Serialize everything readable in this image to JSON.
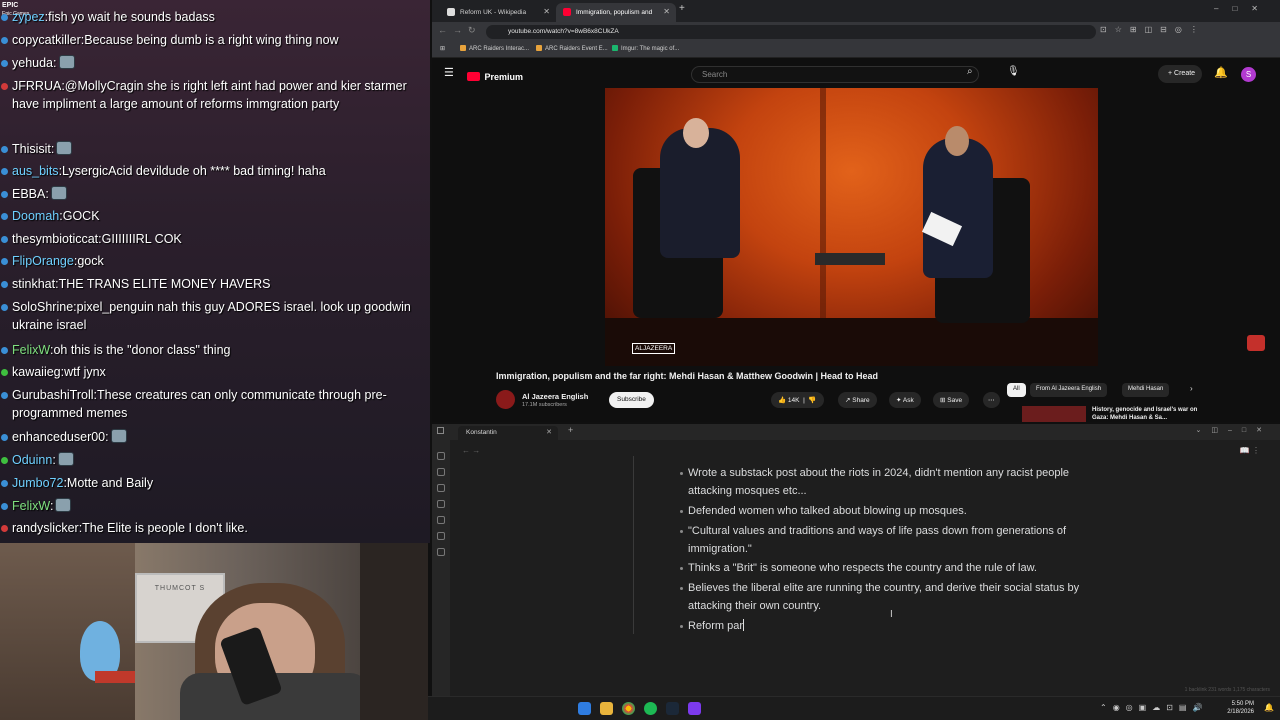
{
  "chat": {
    "epic_badge": "EPIC\nEpic Games",
    "messages": [
      {
        "user": "zypez",
        "text": "fish yo wait he sounds badass",
        "user_color": "#6fd0ff",
        "dot": "#3a8fd6"
      },
      {
        "user": "copycatkiller",
        "text": "Because being dumb is a right wing thing now",
        "user_color": "#ffffff",
        "dot": "#3a8fd6"
      },
      {
        "user": "yehuda",
        "text": "",
        "user_color": "#ffffff",
        "dot": "#3a8fd6",
        "emote": true
      },
      {
        "user": "JFRRUA",
        "text": "@MollyCragin she is right left aint had power and kier starmer have impliment a large amount of reforms immgration party",
        "user_color": "#ffffff",
        "dot": "#d23a3a"
      },
      {
        "user": "Thisisit",
        "text": "",
        "user_color": "#ffffff",
        "dot": "#3a8fd6",
        "emote": true
      },
      {
        "user": "aus_bits",
        "text": "LysergicAcid devildude oh **** bad timing! haha",
        "user_color": "#6fd0ff",
        "dot": "#3a8fd6"
      },
      {
        "user": "EBBA",
        "text": "",
        "user_color": "#ffffff",
        "dot": "#3a8fd6",
        "emote": true
      },
      {
        "user": "Doomah",
        "text": "GOCK",
        "user_color": "#6fd0ff",
        "dot": "#3a8fd6"
      },
      {
        "user": "thesymbioticcat",
        "text": "GIIIIIIIRL COK",
        "user_color": "#ffffff",
        "dot": "#3a8fd6"
      },
      {
        "user": "FlipOrange",
        "text": "gock",
        "user_color": "#6fd0ff",
        "dot": "#3a8fd6"
      },
      {
        "user": "stinkhat",
        "text": "THE TRANS ELITE MONEY HAVERS",
        "user_color": "#ffffff",
        "dot": "#3a8fd6"
      },
      {
        "user": "SoloShrine",
        "text": "pixel_penguin nah this guy ADORES israel. look up goodwin ukraine israel",
        "user_color": "#ffffff",
        "dot": "#3a8fd6"
      },
      {
        "user": "FelixW",
        "text": "oh this is the \"donor class\" thing",
        "user_color": "#7fe07f",
        "dot": "#3a8fd6"
      },
      {
        "user": "kawaiieg",
        "text": "wtf jynx",
        "user_color": "#ffffff",
        "dot": "#3fbf3f"
      },
      {
        "user": "GurubashiTroll",
        "text": "These creatures can only communicate through pre-programmed memes",
        "user_color": "#ffffff",
        "dot": "#3a8fd6"
      },
      {
        "user": "enhanceduser00",
        "text": "",
        "user_color": "#ffffff",
        "dot": "#3a8fd6",
        "emote": true
      },
      {
        "user": "Oduinn",
        "text": "",
        "user_color": "#6fd0ff",
        "dot": "#3fbf3f",
        "emote": true
      },
      {
        "user": "Jumbo72",
        "text": "Motte and Baily",
        "user_color": "#6fd0ff",
        "dot": "#3a8fd6"
      },
      {
        "user": "FelixW",
        "text": "",
        "user_color": "#7fe07f",
        "dot": "#3a8fd6",
        "emote": true
      },
      {
        "user": "randyslicker",
        "text": "The Elite is people I don't like.",
        "user_color": "#ffffff",
        "dot": "#d23a3a"
      }
    ]
  },
  "webcam": {
    "sign_text": "THUMCOT S"
  },
  "browser": {
    "tabs": [
      {
        "label": "Reform UK - Wikipedia",
        "active": false
      },
      {
        "label": "Immigration, populism and",
        "active": true
      }
    ],
    "url": "youtube.com/watch?v=8wB6x8CUkZA",
    "bookmarks": [
      "ARC Raiders Interac...",
      "ARC Raiders Event E...",
      "Imgur: The magic of..."
    ],
    "youtube": {
      "logo": "Premium",
      "search_placeholder": "Search",
      "create_label": "Create",
      "avatar_letter": "S",
      "video_watermark": "ALJAZEERA",
      "title": "Immigration, populism and the far right: Mehdi Hasan & Matthew Goodwin | Head to Head",
      "channel_name": "Al Jazeera English",
      "channel_subs": "17.1M subscribers",
      "subscribe_label": "Subscribe",
      "likes": "14K",
      "share_label": "Share",
      "ask_label": "Ask",
      "save_label": "Save",
      "chips": [
        "All",
        "From Al Jazeera English",
        "Mehdi Hasan"
      ],
      "rec_title": "History, genocide and Israel's war on Gaza: Mehdi Hasan & Sa..."
    }
  },
  "notes": {
    "tab_title": "Konstantin",
    "bullets": [
      "Wrote a substack post about the riots in 2024, didn't mention any racist people attacking mosques etc...",
      "Defended women who talked about blowing up mosques.",
      "\"Cultural values and traditions and ways of life pass down from generations of immigration.\"",
      "Thinks a \"Brit\" is someone who respects the country and the rule of law.",
      "Believes the liberal elite are running the country, and derive their social status by attacking their own country.",
      "Reform par"
    ],
    "status": "1 backlink   231 words   1,175 characters"
  },
  "taskbar": {
    "time": "5:50 PM",
    "date": "2/18/2026"
  }
}
